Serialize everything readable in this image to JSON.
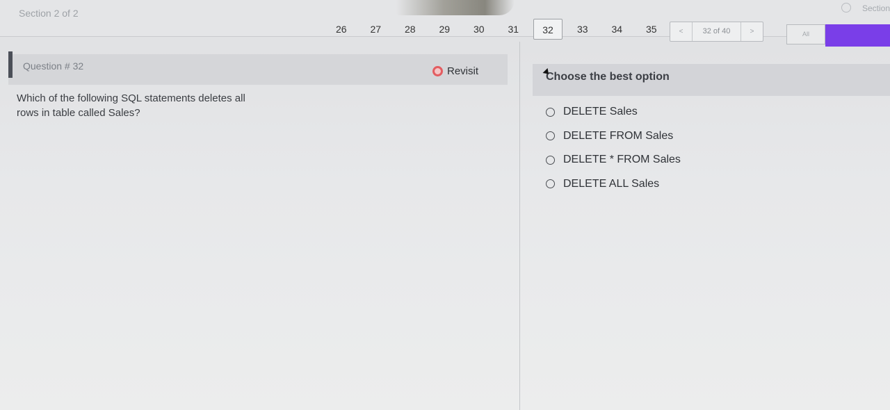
{
  "header": {
    "section_label": "Section 2 of 2",
    "section_right": "Section",
    "page_numbers": [
      "26",
      "27",
      "28",
      "29",
      "30",
      "31",
      "32",
      "33",
      "34",
      "35"
    ],
    "current_page": "32",
    "pager": {
      "prev": "<",
      "text": "32 of 40",
      "next": ">"
    },
    "all_label": "All",
    "accent_color": "#7a3ee8"
  },
  "question": {
    "title": "Question # 32",
    "revisit_label": "Revisit",
    "text": "Which of the following SQL statements deletes all rows in table called Sales?"
  },
  "answers": {
    "prompt": "Choose the best option",
    "options": [
      "DELETE Sales",
      "DELETE FROM Sales",
      "DELETE * FROM Sales",
      "DELETE ALL Sales"
    ]
  }
}
